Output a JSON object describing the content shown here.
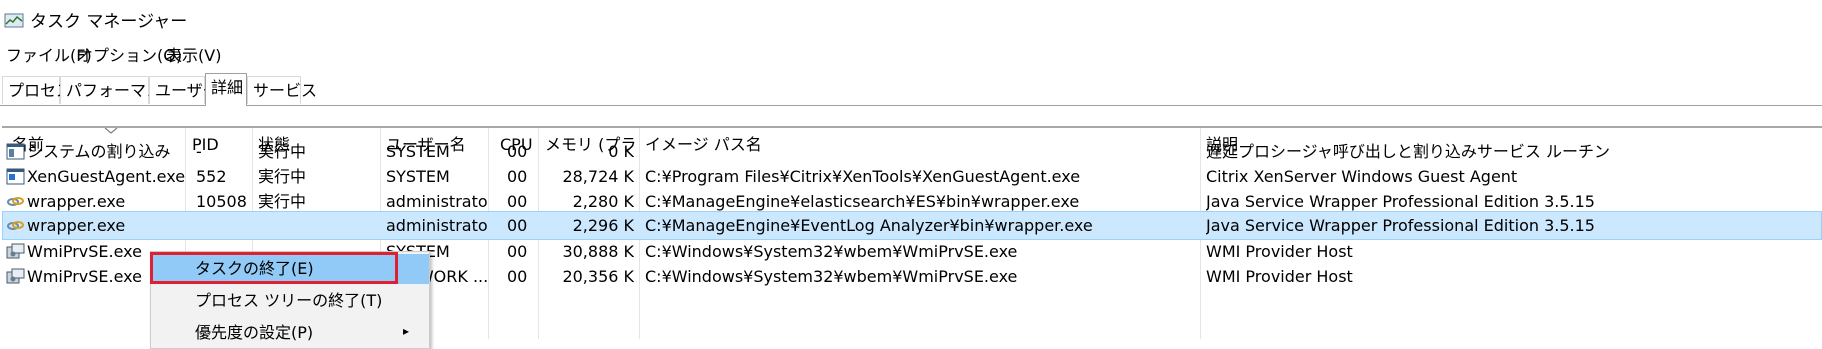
{
  "window": {
    "title": "タスク マネージャー"
  },
  "menu": [
    {
      "label": "ファイル(F)"
    },
    {
      "label": "オプション(O)"
    },
    {
      "label": "表示(V)"
    }
  ],
  "tabs": [
    {
      "label": "プロセス"
    },
    {
      "label": "パフォーマンス"
    },
    {
      "label": "ユーザー"
    },
    {
      "label": "詳細",
      "active": true
    },
    {
      "label": "サービス"
    }
  ],
  "table": {
    "columns": {
      "name": "名前",
      "pid": "PID",
      "status": "状態",
      "user": "ユーザー名",
      "cpu": "CPU",
      "memory": "メモリ (プライ...",
      "image_path": "イメージ パス名",
      "description": "説明"
    },
    "sort_column": "name",
    "rows": [
      {
        "icon": "system-window-icon",
        "name": "システムの割り込み",
        "pid": "-",
        "status": "実行中",
        "user": "SYSTEM",
        "cpu": "00",
        "memory": "0 K",
        "image_path": "",
        "description": "遅延プロシージャ呼び出しと割り込みサービス ルーチン"
      },
      {
        "icon": "app-window-icon",
        "name": "XenGuestAgent.exe",
        "pid": "552",
        "status": "実行中",
        "user": "SYSTEM",
        "cpu": "00",
        "memory": "28,724 K",
        "image_path": "C:¥Program Files¥Citrix¥XenTools¥XenGuestAgent.exe",
        "description": "Citrix XenServer Windows Guest Agent"
      },
      {
        "icon": "chain-link-icon",
        "name": "wrapper.exe",
        "pid": "10508",
        "status": "実行中",
        "user": "administrator",
        "cpu": "00",
        "memory": "2,280 K",
        "image_path": "C:¥ManageEngine¥elasticsearch¥ES¥bin¥wrapper.exe",
        "description": "Java Service Wrapper Professional Edition 3.5.15"
      },
      {
        "icon": "chain-link-icon",
        "name": "wrapper.exe",
        "pid": "",
        "status": "",
        "user": "administrator",
        "cpu": "00",
        "memory": "2,296 K",
        "image_path": "C:¥ManageEngine¥EventLog Analyzer¥bin¥wrapper.exe",
        "description": "Java Service Wrapper Professional Edition 3.5.15",
        "selected": true
      },
      {
        "icon": "wmi-provider-icon",
        "name": "WmiPrvSE.exe",
        "pid": "",
        "status": "",
        "user": "SYSTEM",
        "cpu": "00",
        "memory": "30,888 K",
        "image_path": "C:¥Windows¥System32¥wbem¥WmiPrvSE.exe",
        "description": "WMI Provider Host"
      },
      {
        "icon": "wmi-provider-icon",
        "name": "WmiPrvSE.exe",
        "pid": "",
        "status": "",
        "user": "NETWORK ...",
        "cpu": "00",
        "memory": "20,356 K",
        "image_path": "C:¥Windows¥System32¥wbem¥WmiPrvSE.exe",
        "description": "WMI Provider Host"
      }
    ]
  },
  "context_menu": {
    "items": [
      {
        "label": "タスクの終了(E)",
        "highlighted": true
      },
      {
        "label": "プロセス ツリーの終了(T)"
      },
      {
        "label": "優先度の設定(P)",
        "submenu": true
      }
    ]
  },
  "colors": {
    "selection_bg": "#cce8ff",
    "menu_highlight": "#91c9f7",
    "annotation_outline": "#e02030"
  }
}
